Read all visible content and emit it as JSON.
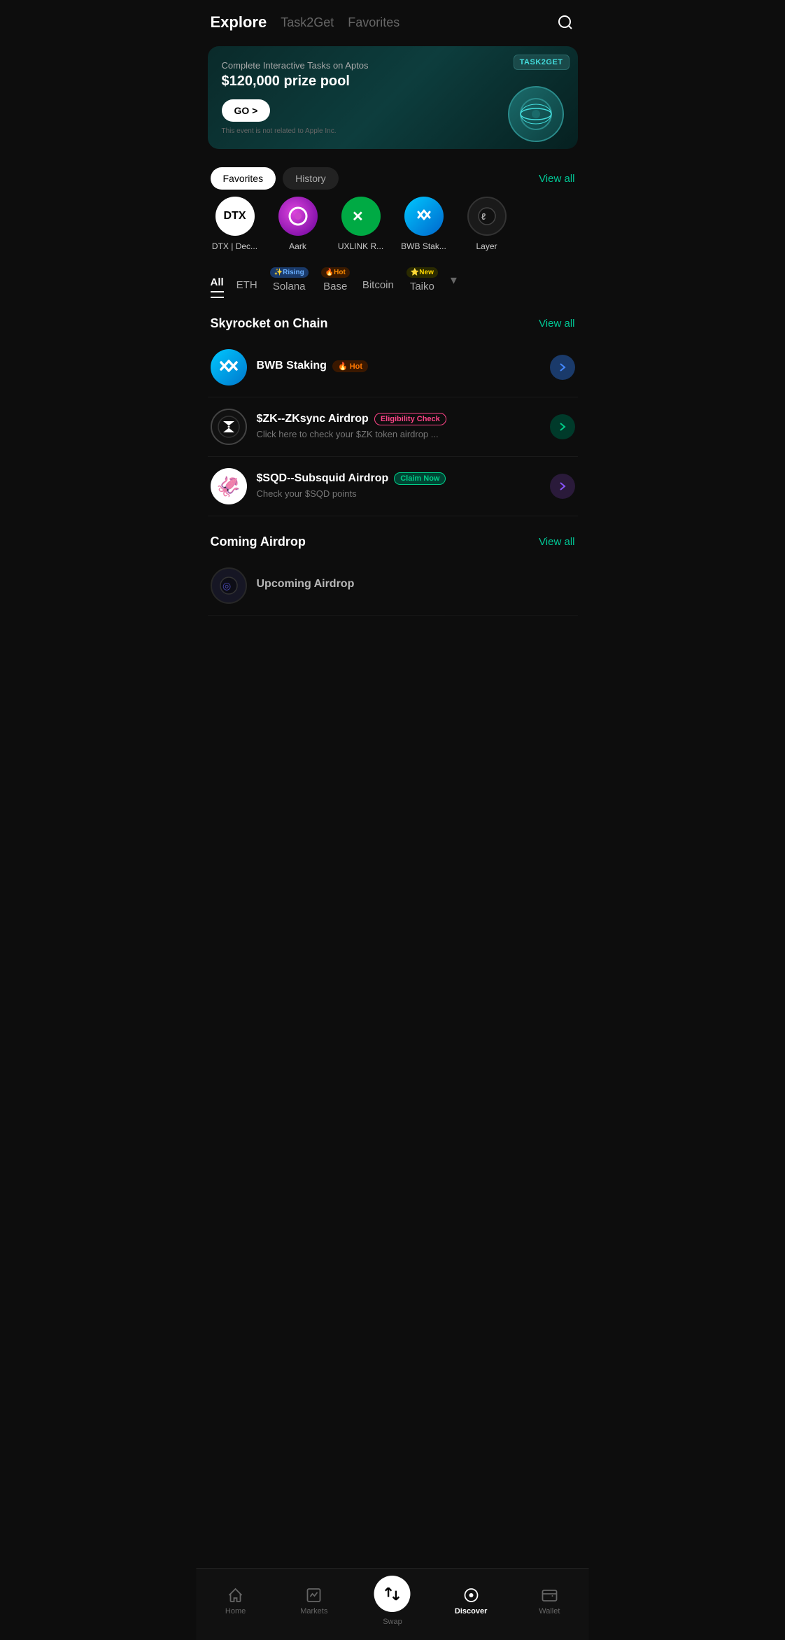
{
  "header": {
    "title": "Explore",
    "nav": [
      "Task2Get",
      "Favorites"
    ],
    "search_label": "search"
  },
  "banner": {
    "tag": "TASK2GET",
    "subtitle": "Complete Interactive Tasks on Aptos",
    "prize": "$120,000 prize pool",
    "button_label": "GO >",
    "disclaimer": "This event is not related to Apple Inc."
  },
  "tabs": {
    "favorites_label": "Favorites",
    "history_label": "History",
    "view_all_label": "View all"
  },
  "favorites": [
    {
      "symbol": "DTX",
      "label": "DTX | Dec...",
      "bg": "white",
      "fg": "black"
    },
    {
      "symbol": "C",
      "label": "Aark",
      "bg": "purple"
    },
    {
      "symbol": "UX",
      "label": "UXLINK R...",
      "bg": "green"
    },
    {
      "symbol": "<<",
      "label": "BWB Stak...",
      "bg": "blue"
    },
    {
      "symbol": "◑",
      "label": "Layer",
      "bg": "dark"
    }
  ],
  "chain_filter": {
    "items": [
      {
        "label": "All",
        "active": true,
        "badge": null
      },
      {
        "label": "ETH",
        "active": false,
        "badge": null
      },
      {
        "label": "Solana",
        "active": false,
        "badge": "✨Rising"
      },
      {
        "label": "Base",
        "active": false,
        "badge": "🔥Hot"
      },
      {
        "label": "Bitcoin",
        "active": false,
        "badge": null
      },
      {
        "label": "Taiko",
        "active": false,
        "badge": "⭐New"
      }
    ]
  },
  "skyrocket": {
    "section_title": "Skyrocket on Chain",
    "view_all_label": "View all",
    "items": [
      {
        "name": "BWB Staking",
        "badge": "🔥 Hot",
        "badge_type": "hot",
        "desc": "",
        "icon": "<<"
      },
      {
        "name": "$ZK--ZKsync Airdrop",
        "badge": "Eligibility Check",
        "badge_type": "eligibility",
        "desc": "Click here to check your $ZK token airdrop ...",
        "icon": "↔"
      },
      {
        "name": "$SQD--Subsquid Airdrop",
        "badge": "Claim Now",
        "badge_type": "claim",
        "desc": "Check your $SQD points",
        "icon": "🐙"
      }
    ]
  },
  "coming_airdrop": {
    "section_title": "Coming Airdrop",
    "view_all_label": "View all"
  },
  "bottom_nav": {
    "items": [
      {
        "label": "Home",
        "icon": "home"
      },
      {
        "label": "Markets",
        "icon": "markets"
      },
      {
        "label": "Swap",
        "icon": "swap",
        "special": true
      },
      {
        "label": "Discover",
        "icon": "discover",
        "active": true
      },
      {
        "label": "Wallet",
        "icon": "wallet"
      }
    ]
  }
}
